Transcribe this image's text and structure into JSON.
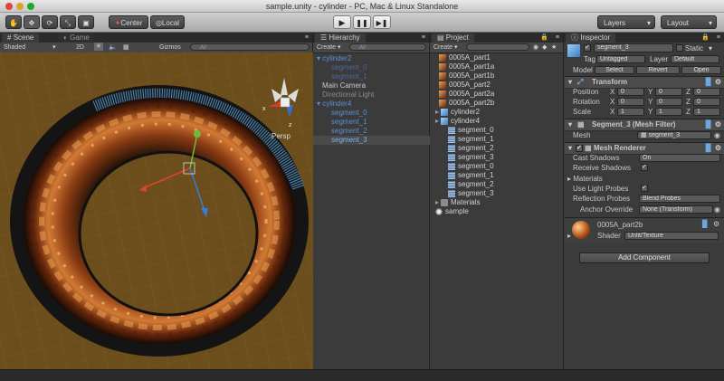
{
  "window": {
    "title": "sample.unity - cylinder - PC, Mac & Linux Standalone"
  },
  "toolbar": {
    "pivot_label": "Center",
    "space_label": "Local",
    "layers_label": "Layers",
    "layout_label": "Layout",
    "play_icon": "play-icon",
    "pause_icon": "pause-icon",
    "step_icon": "step-icon"
  },
  "scene": {
    "tab_scene": "Scene",
    "tab_game": "Game",
    "shading": "Shaded",
    "mode_2d": "2D",
    "gizmos": "Gizmos",
    "search_placeholder": "All",
    "persp_label": "Persp",
    "gizmo_axis_x": "x",
    "gizmo_axis_z": "z",
    "background_color": "#6b4e1c"
  },
  "hierarchy": {
    "tab": "Hierarchy",
    "create": "Create",
    "search_placeholder": "All",
    "items": [
      {
        "label": "cylinder2",
        "style": "blue",
        "expanded": true
      },
      {
        "label": "segment_0",
        "style": "blue-dim"
      },
      {
        "label": "segment_1",
        "style": "blue-dim"
      },
      {
        "label": "Main Camera",
        "style": "normal"
      },
      {
        "label": "Directional Light",
        "style": "dim"
      },
      {
        "label": "cylinder4",
        "style": "blue",
        "expanded": true
      },
      {
        "label": "segment_0",
        "style": "blue"
      },
      {
        "label": "segment_1",
        "style": "blue"
      },
      {
        "label": "segment_2",
        "style": "blue"
      },
      {
        "label": "segment_3",
        "style": "selected"
      }
    ]
  },
  "project": {
    "tab": "Project",
    "create": "Create",
    "items": [
      {
        "label": "0005A_part1",
        "icon": "texture-icon"
      },
      {
        "label": "0005A_part1a",
        "icon": "texture-icon"
      },
      {
        "label": "0005A_part1b",
        "icon": "texture-icon"
      },
      {
        "label": "0005A_part2",
        "icon": "texture-icon"
      },
      {
        "label": "0005A_part2a",
        "icon": "texture-icon"
      },
      {
        "label": "0005A_part2b",
        "icon": "texture-icon"
      },
      {
        "label": "cylinder2",
        "icon": "model-icon"
      },
      {
        "label": "cylinder4",
        "icon": "model-icon"
      },
      {
        "label": "segment_0",
        "icon": "mesh-icon"
      },
      {
        "label": "segment_1",
        "icon": "mesh-icon"
      },
      {
        "label": "segment_2",
        "icon": "mesh-icon"
      },
      {
        "label": "segment_3",
        "icon": "mesh-icon"
      },
      {
        "label": "segment_0",
        "icon": "mesh-icon"
      },
      {
        "label": "segment_1",
        "icon": "mesh-icon"
      },
      {
        "label": "segment_2",
        "icon": "mesh-icon"
      },
      {
        "label": "segment_3",
        "icon": "mesh-icon"
      },
      {
        "label": "Materials",
        "icon": "folder-icon"
      },
      {
        "label": "sample",
        "icon": "scene-icon"
      }
    ]
  },
  "inspector": {
    "tab": "Inspector",
    "object_name": "segment_3",
    "static_label": "Static",
    "tag_label": "Tag",
    "tag_value": "Untagged",
    "layer_label": "Layer",
    "layer_value": "Default",
    "model_label": "Model",
    "model_select": "Select",
    "model_revert": "Revert",
    "model_open": "Open",
    "transform": {
      "title": "Transform",
      "rows": [
        {
          "label": "Position",
          "x": "0",
          "y": "0",
          "z": "0"
        },
        {
          "label": "Rotation",
          "x": "0",
          "y": "0",
          "z": "0"
        },
        {
          "label": "Scale",
          "x": "1",
          "y": "1",
          "z": "1"
        }
      ]
    },
    "mesh_filter": {
      "title": "Segment_3 (Mesh Filter)",
      "mesh_label": "Mesh",
      "mesh_value": "segment_3"
    },
    "mesh_renderer": {
      "title": "Mesh Renderer",
      "cast_shadows_label": "Cast Shadows",
      "cast_shadows_value": "On",
      "receive_shadows_label": "Receive Shadows",
      "materials_label": "Materials",
      "light_probes_label": "Use Light Probes",
      "reflection_probes_label": "Reflection Probes",
      "reflection_probes_value": "Blend Probes",
      "anchor_override_label": "Anchor Override",
      "anchor_override_value": "None (Transform)"
    },
    "material": {
      "name": "0005A_part2b",
      "shader_label": "Shader",
      "shader_value": "Unlit/Texture"
    },
    "add_component": "Add Component"
  }
}
